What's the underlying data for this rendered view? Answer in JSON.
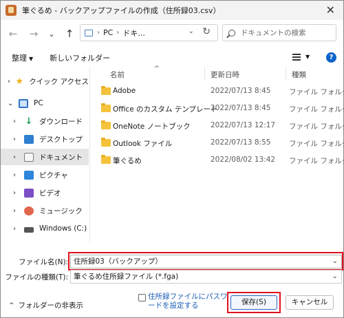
{
  "window": {
    "title": "筆ぐるめ - バックアップファイルの作成（住所録03.csv）",
    "close_glyph": "✕"
  },
  "nav": {
    "back": "←",
    "forward": "→",
    "recent": "⌄",
    "up": "↑"
  },
  "address": {
    "crumbs": [
      "PC",
      "ドキ..."
    ],
    "separator": "›",
    "chevron": "⌄",
    "refresh": "↻"
  },
  "search": {
    "placeholder": "ドキュメントの検索"
  },
  "commands": {
    "organize": "整理",
    "organize_caret": "▼",
    "new_folder": "新しいフォルダー",
    "view_caret": "▼",
    "help": "?"
  },
  "sidebar": {
    "items": [
      {
        "label": "クイック アクセス",
        "icon": "star-icon",
        "expanded": false,
        "selected": false
      },
      {
        "label": "PC",
        "icon": "pc-icon",
        "expanded": true,
        "selected": false
      },
      {
        "label": "ダウンロード",
        "icon": "download-icon",
        "expanded": false,
        "selected": false
      },
      {
        "label": "デスクトップ",
        "icon": "desktop-icon",
        "expanded": false,
        "selected": false
      },
      {
        "label": "ドキュメント",
        "icon": "documents-icon",
        "expanded": false,
        "selected": true
      },
      {
        "label": "ピクチャ",
        "icon": "pictures-icon",
        "expanded": false,
        "selected": false
      },
      {
        "label": "ビデオ",
        "icon": "videos-icon",
        "expanded": false,
        "selected": false
      },
      {
        "label": "ミュージック",
        "icon": "music-icon",
        "expanded": false,
        "selected": false
      },
      {
        "label": "Windows (C:)",
        "icon": "drive-icon",
        "expanded": false,
        "selected": false
      }
    ],
    "chevron_collapsed": "›",
    "chevron_expanded": "⌄"
  },
  "filelist": {
    "columns": {
      "name": "名前",
      "date": "更新日時",
      "type": "種類"
    },
    "sort_caret": "^",
    "rows": [
      {
        "name": "Adobe",
        "date": "2022/07/13 8:45",
        "type": "ファイル フォルダー"
      },
      {
        "name": "Office のカスタム テンプレート",
        "date": "2022/07/13 8:45",
        "type": "ファイル フォルダー"
      },
      {
        "name": "OneNote ノートブック",
        "date": "2022/07/13 12:17",
        "type": "ファイル フォルダー"
      },
      {
        "name": "Outlook ファイル",
        "date": "2022/07/13 8:55",
        "type": "ファイル フォルダー"
      },
      {
        "name": "筆ぐるめ",
        "date": "2022/08/02 13:42",
        "type": "ファイル フォルダー"
      }
    ]
  },
  "form": {
    "filename_label": "ファイル名(N):",
    "filename_value": "住所録03（バックアップ）",
    "filetype_label": "ファイルの種類(T):",
    "filetype_value": "筆ぐるめ住所録ファイル (*.fga)",
    "field_chevron": "⌄",
    "hide_folders": "フォルダーの非表示",
    "hide_caret": "^",
    "password_option": "住所録ファイルにパスワードを設定する",
    "save_label": "保存(S)",
    "cancel_label": "キャンセル"
  },
  "colors": {
    "highlight": "#e0101c",
    "accent": "#2c64c0",
    "folder": "#f5c33b"
  }
}
